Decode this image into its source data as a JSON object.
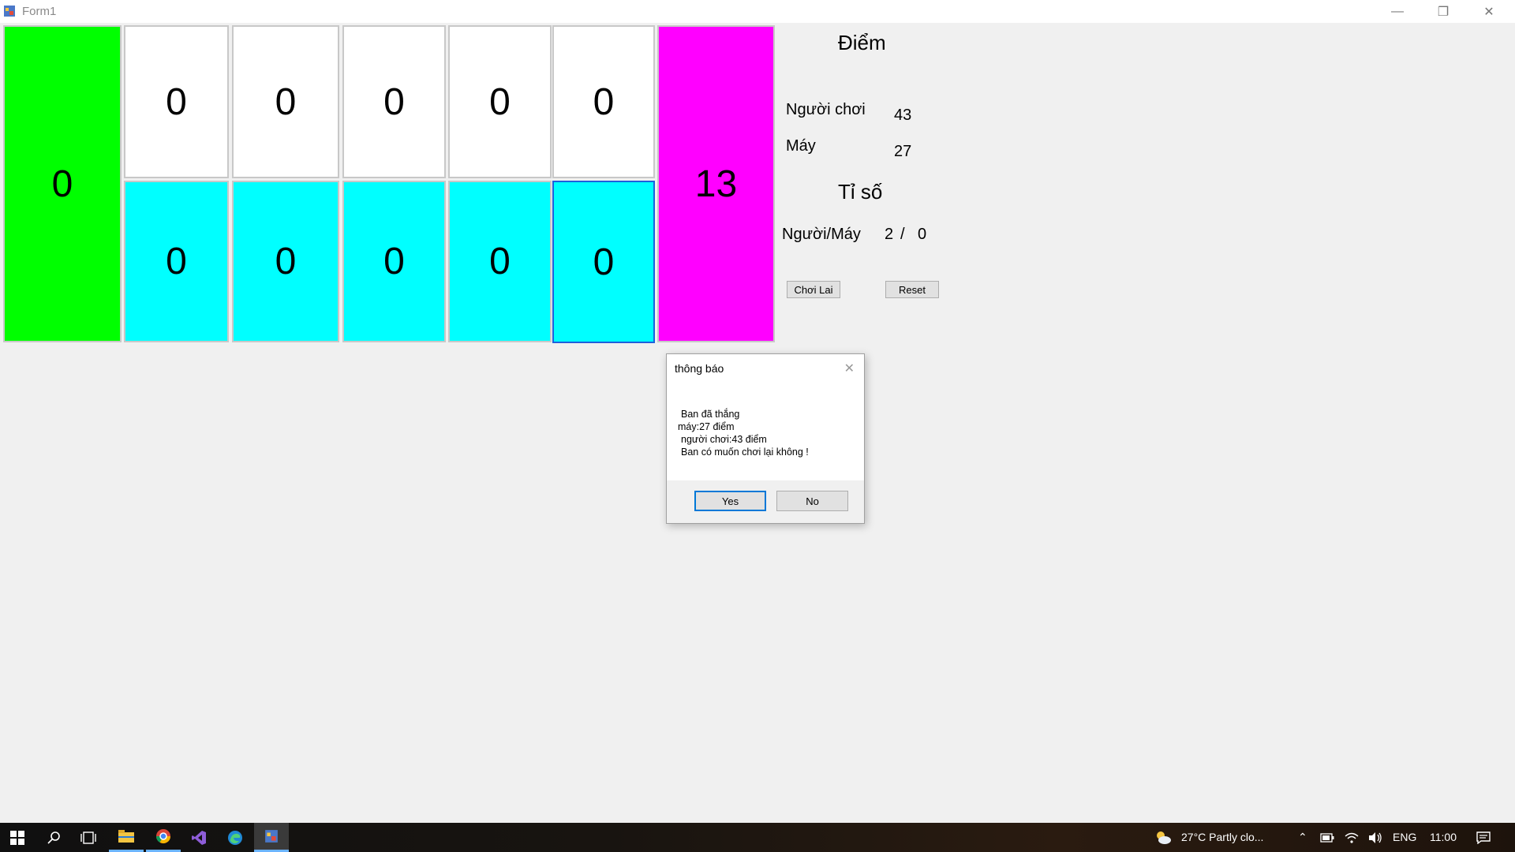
{
  "window": {
    "title": "Form1",
    "minimize": "—",
    "restore": "❐",
    "close": "✕"
  },
  "board": {
    "left_store": "0",
    "right_store": "13",
    "top_row": [
      "0",
      "0",
      "0",
      "0",
      "0"
    ],
    "bottom_row": [
      "0",
      "0",
      "0",
      "0",
      "0"
    ]
  },
  "panel": {
    "score_heading": "Điểm",
    "player_label": "Người chơi",
    "player_score": "43",
    "machine_label": "Máy",
    "machine_score": "27",
    "ratio_heading": "Tỉ số",
    "ratio_label": "Người/Máy",
    "ratio_player": "2",
    "ratio_sep": "/",
    "ratio_machine": "0",
    "play_again": "Chơi Lai",
    "reset": "Reset"
  },
  "dialog": {
    "title": "thông báo",
    "line1": "Ban đã thắng",
    "line2": "máy:27 điểm",
    "line3": "người chơi:43 điểm",
    "line4": "Ban có muốn chơi lại không !",
    "yes": "Yes",
    "no": "No"
  },
  "taskbar": {
    "weather": "27°C  Partly clo...",
    "language": "ENG",
    "time": "11:00"
  },
  "colors": {
    "left_store": "#00ff00",
    "right_store": "#ff00ff",
    "top_cells": "#ffffff",
    "bottom_cells": "#00ffff",
    "selection": "#1f5fdb"
  }
}
